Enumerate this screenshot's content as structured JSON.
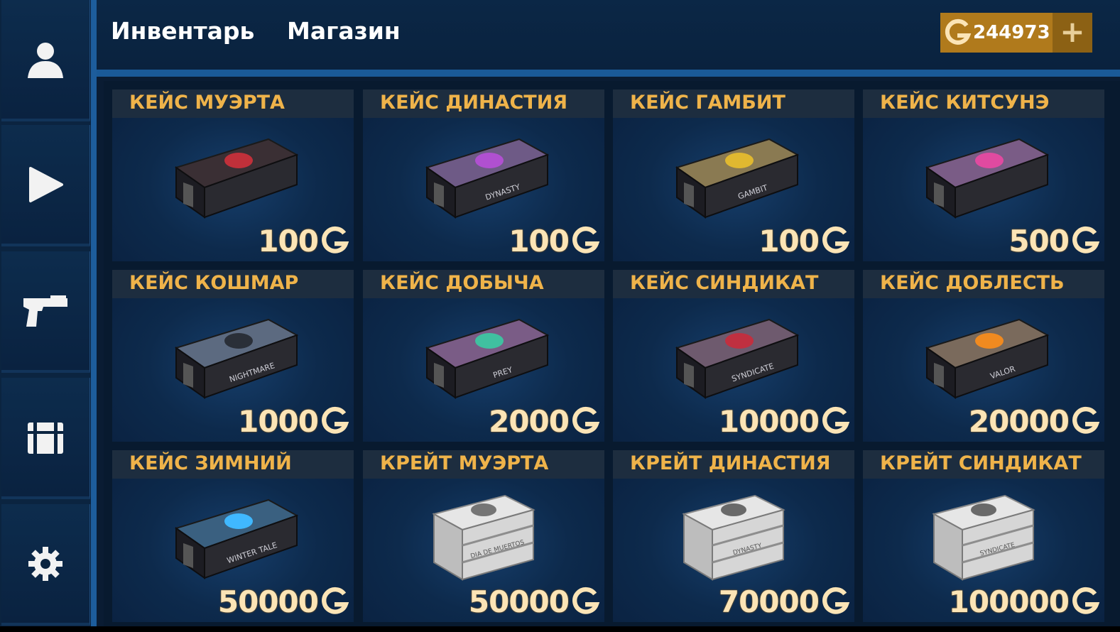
{
  "header": {
    "tabs": [
      {
        "label": "Инвентарь"
      },
      {
        "label": "Магазин"
      }
    ],
    "balance": "244973",
    "add_label": "+"
  },
  "sidebar": {
    "items": [
      {
        "icon": "profile-icon"
      },
      {
        "icon": "play-icon"
      },
      {
        "icon": "pistol-icon"
      },
      {
        "icon": "case-icon"
      },
      {
        "icon": "gear-icon"
      }
    ]
  },
  "colors": {
    "title_text": "#efb34a",
    "price_text": "#fbe4b6",
    "currency_bg": "#b07a1c",
    "accent_blue": "#1d5d9c"
  },
  "cards": [
    {
      "title": "КЕЙС МУЭРТА",
      "price": "100",
      "kind": "case",
      "emblem_color": "#c0303a",
      "lid": "#3a2f34",
      "label": ""
    },
    {
      "title": "КЕЙС ДИНАСТИЯ",
      "price": "100",
      "kind": "case",
      "emblem_color": "#b050d0",
      "lid": "#6e5a86",
      "label": "DYNASTY"
    },
    {
      "title": "КЕЙС ГАМБИТ",
      "price": "100",
      "kind": "case",
      "emblem_color": "#e0b830",
      "lid": "#8a7a52",
      "label": "GAMBIT"
    },
    {
      "title": "КЕЙС КИТСУНЭ",
      "price": "500",
      "kind": "case",
      "emblem_color": "#e04aa0",
      "lid": "#7a5c86",
      "label": ""
    },
    {
      "title": "КЕЙС КОШМАР",
      "price": "1000",
      "kind": "case",
      "emblem_color": "#2a2f38",
      "lid": "#5c6a80",
      "label": "NIGHTMARE"
    },
    {
      "title": "КЕЙС ДОБЫЧА",
      "price": "2000",
      "kind": "case",
      "emblem_color": "#40c0a0",
      "lid": "#7a5c86",
      "label": "PREY"
    },
    {
      "title": "КЕЙС СИНДИКАТ",
      "price": "10000",
      "kind": "case",
      "emblem_color": "#c03040",
      "lid": "#6e5a6e",
      "label": "SYNDICATE"
    },
    {
      "title": "КЕЙС ДОБЛЕСТЬ",
      "price": "20000",
      "kind": "case",
      "emblem_color": "#f08a20",
      "lid": "#7a6a5c",
      "label": "VALOR"
    },
    {
      "title": "КЕЙС ЗИМНИЙ",
      "price": "50000",
      "kind": "case",
      "emblem_color": "#40b8ff",
      "lid": "#3a6080",
      "label": "WINTER TALE"
    },
    {
      "title": "КРЕЙТ МУЭРТА",
      "price": "50000",
      "kind": "crate",
      "emblem_color": "#444444",
      "lid": "#d8d8d8",
      "label": "DIA DE MUERTOS"
    },
    {
      "title": "КРЕЙТ ДИНАСТИЯ",
      "price": "70000",
      "kind": "crate",
      "emblem_color": "#333333",
      "lid": "#d8d8d8",
      "label": "DYNASTY"
    },
    {
      "title": "КРЕЙТ СИНДИКАТ",
      "price": "100000",
      "kind": "crate",
      "emblem_color": "#333333",
      "lid": "#d8d8d8",
      "label": "SYNDICATE"
    }
  ]
}
